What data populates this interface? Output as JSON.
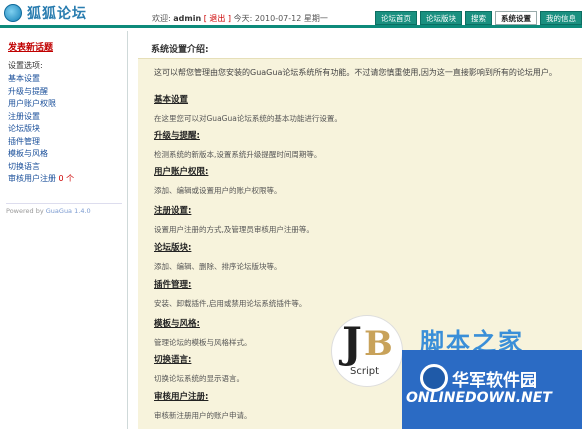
{
  "header": {
    "logo_text": "狐狐论坛",
    "user_prefix": "欢迎:",
    "username": "admin",
    "logout_label": "[ 退出 ]",
    "date_prefix": "今天:",
    "date": "2010-07-12 星期一",
    "tabs": [
      {
        "label": "论坛首页"
      },
      {
        "label": "论坛版块"
      },
      {
        "label": "搜索"
      },
      {
        "label": "系统设置"
      },
      {
        "label": "我的信息"
      }
    ]
  },
  "sidebar": {
    "new_post": "发表新话题",
    "section_title": "设置选项:",
    "items": [
      {
        "label": "基本设置"
      },
      {
        "label": "升级与提醒"
      },
      {
        "label": "用户账户权限"
      },
      {
        "label": "注册设置"
      },
      {
        "label": "论坛版块"
      },
      {
        "label": "插件管理"
      },
      {
        "label": "模板与风格"
      },
      {
        "label": "切换语言"
      },
      {
        "label": "审核用户注册",
        "badge": "0 个"
      }
    ],
    "powered_prefix": "Powered by",
    "powered_link": "GuaGua 1.4.0"
  },
  "main": {
    "title": "系统设置介绍:",
    "intro": "这可以帮您管理由您安装的GuaGua论坛系统所有功能。不过请您慎重使用,因为这一直接影响到所有的论坛用户。",
    "sections": [
      {
        "title": "基本设置",
        "desc": "在这里您可以对GuaGua论坛系统的基本功能进行设置。"
      },
      {
        "title": "升级与提醒:",
        "desc": "检测系统的新版本,设置系统升级提醒时间周期等。"
      },
      {
        "title": "用户账户权限:",
        "desc": "添加、编辑或设置用户的账户权限等。"
      },
      {
        "title": "注册设置:",
        "desc": "设置用户注册的方式,及管理员审核用户注册等。"
      },
      {
        "title": "论坛版块:",
        "desc": "添加、编辑、删除、排序论坛版块等。"
      },
      {
        "title": "插件管理:",
        "desc": "安装、卸载插件,启用或禁用论坛系统插件等。"
      },
      {
        "title": "模板与风格:",
        "desc": "管理论坛的模板与风格样式。"
      },
      {
        "title": "切换语言:",
        "desc": "切换论坛系统的显示语言。"
      },
      {
        "title": "审核用户注册:",
        "desc": "审核新注册用户的账户申请。"
      }
    ]
  },
  "watermarks": {
    "jb_script": "Script",
    "cn_site": "脚本之家",
    "cn_site2": "华军软件园",
    "en_site": "ONLINEDOWN.NET"
  }
}
